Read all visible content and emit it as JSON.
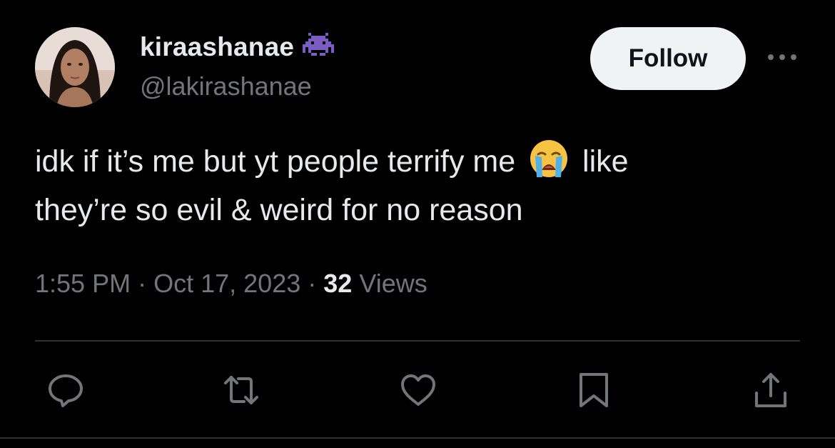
{
  "tweet": {
    "author": {
      "display_name": "kiraashanae",
      "handle": "@lakirashanae",
      "badge_icon": "alien-monster-icon"
    },
    "follow_label": "Follow",
    "text_part1": "idk if it’s me but yt people terrify me",
    "emoji": "loudly-crying-face-icon",
    "text_part2": "like",
    "text_line2": "they’re so evil & weird for no reason",
    "time": "1:55 PM",
    "separator": "·",
    "date": "Oct 17, 2023",
    "views_count": "32",
    "views_label": "Views"
  },
  "actions": [
    "reply-icon",
    "retweet-icon",
    "like-icon",
    "bookmark-icon",
    "share-icon"
  ],
  "colors": {
    "background": "#000000",
    "text": "#e7e9ea",
    "muted": "#71767b",
    "divider": "#2f3336",
    "follow_bg": "#eff3f4",
    "badge": "#7b5cc4"
  }
}
